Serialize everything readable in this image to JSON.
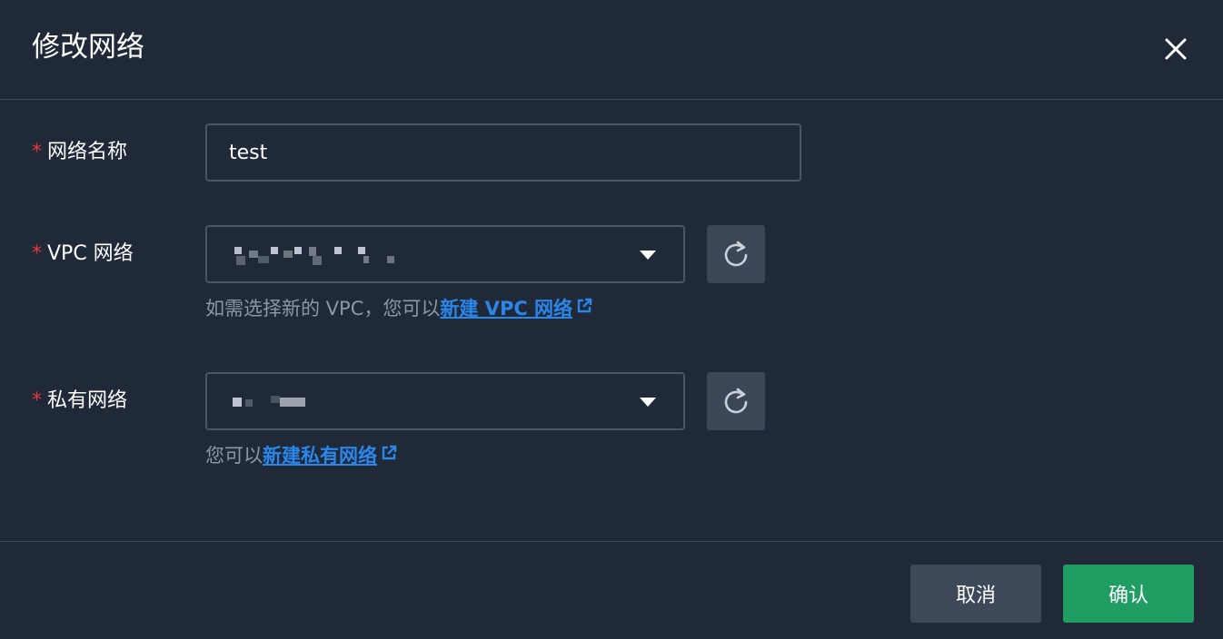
{
  "dialog": {
    "title": "修改网络",
    "close_icon": "close-icon"
  },
  "form": {
    "required_mark": "*",
    "network_name": {
      "label": "网络名称",
      "value": "test"
    },
    "vpc": {
      "label": "VPC 网络",
      "value": "",
      "hint_prefix": "如需选择新的 VPC，您可以",
      "hint_link": "新建 VPC 网络",
      "refresh_icon": "refresh-icon",
      "external_icon": "external-link-icon"
    },
    "private_network": {
      "label": "私有网络",
      "value": "",
      "hint_prefix": "您可以",
      "hint_link": "新建私有网络",
      "refresh_icon": "refresh-icon",
      "external_icon": "external-link-icon"
    }
  },
  "footer": {
    "cancel_label": "取消",
    "confirm_label": "确认"
  },
  "colors": {
    "background": "#1f2938",
    "required": "#e5393d",
    "link": "#2b86ea",
    "confirm": "#1f9d62",
    "cancel": "#3d4859"
  }
}
